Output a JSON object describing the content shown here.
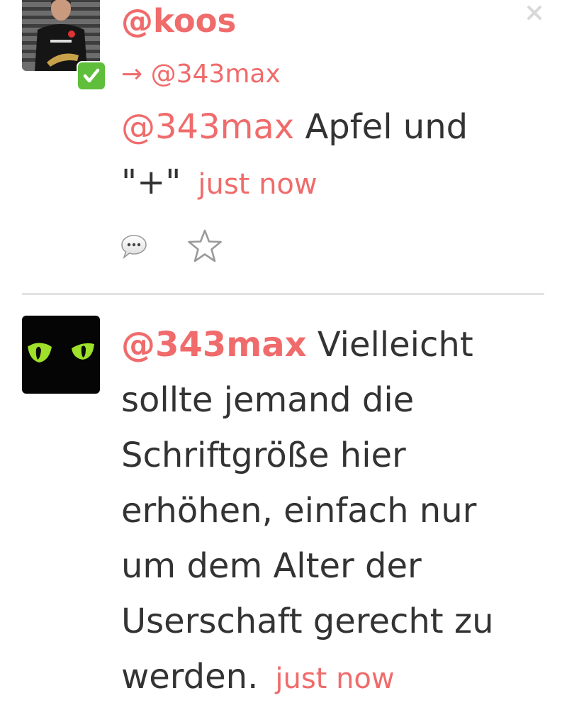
{
  "posts": [
    {
      "author": "@koos",
      "reply_to": "→ @343max",
      "mention": "@343max",
      "text_line1": " Apfel und",
      "text_line2": "\"+\"",
      "timestamp": "just now",
      "verified_icon": "check-mark-icon",
      "actions": [
        "reply-bubble-icon",
        "star-icon"
      ]
    },
    {
      "mention": "@343max",
      "text_line1": " Vielleicht",
      "text_lines": [
        "sollte jemand die",
        "Schriftgröße hier",
        "erhöhen, einfach nur",
        "um dem Alter der",
        "Userschaft gerecht zu"
      ],
      "last_line": "werden.",
      "timestamp": "just now"
    }
  ],
  "colors": {
    "accent": "#f06b6b",
    "text": "#333333",
    "divider": "#e3e3e3",
    "verified": "#5fbf3a"
  }
}
